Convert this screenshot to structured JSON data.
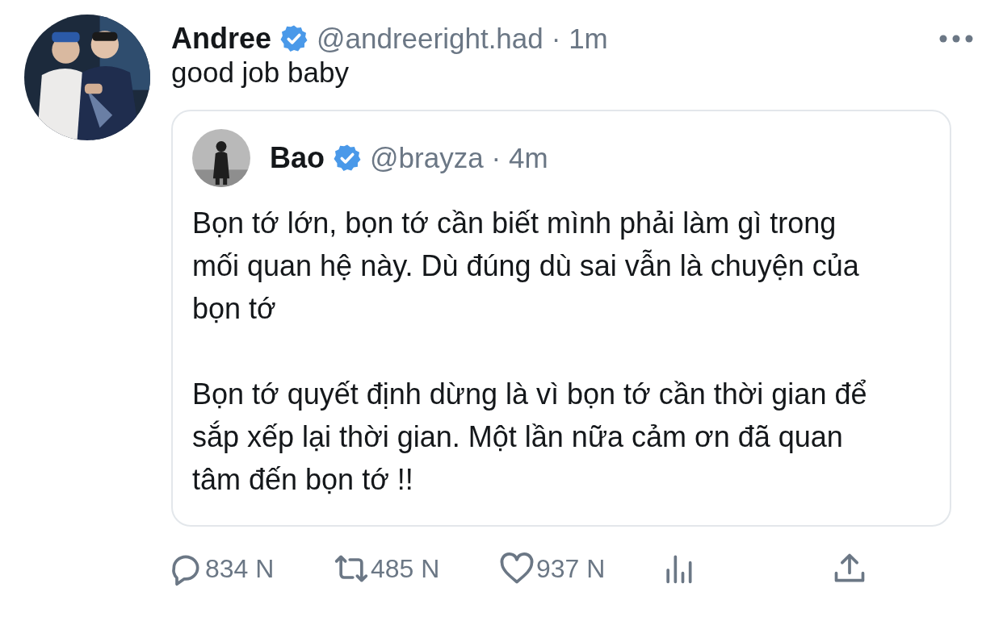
{
  "tweet": {
    "author": {
      "name": "Andree",
      "verified": true,
      "handle": "@andreeright.had",
      "time": "· 1m"
    },
    "text": "good job baby",
    "quote": {
      "author": {
        "name": "Bao",
        "verified": true,
        "handle": "@brayza",
        "time": "· 4m"
      },
      "paragraphs": [
        "Bọn tớ lớn, bọn tớ cần biết mình phải làm gì trong mối quan hệ này. Dù đúng dù sai vẫn là chuyện của bọn tớ",
        "Bọn tớ quyết định dừng là vì bọn tớ cần thời gian để sắp xếp lại thời gian. Một lần nữa cảm ơn đã quan tâm đến bọn tớ !!"
      ]
    },
    "actions": [
      {
        "kind": "reply",
        "count": "834 N"
      },
      {
        "kind": "retweet",
        "count": "485 N"
      },
      {
        "kind": "like",
        "count": "937 N"
      },
      {
        "kind": "stats"
      },
      {
        "kind": "share"
      }
    ]
  }
}
